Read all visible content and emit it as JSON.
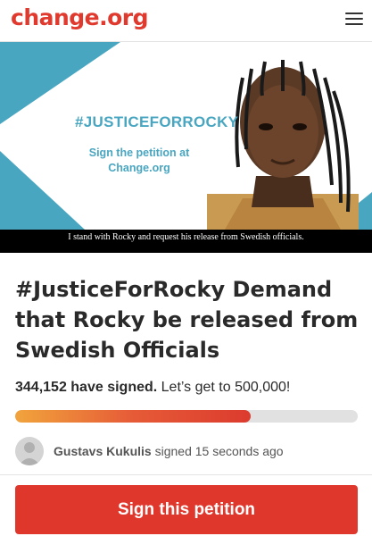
{
  "header": {
    "logo": "change.org",
    "menu_icon": "hamburger-menu-icon"
  },
  "banner": {
    "hashtag": "#JUSTICEFORROCKY",
    "sign_line1": "Sign the petition at",
    "sign_line2": "Change.org",
    "caption": "I stand with Rocky and request his release from Swedish officials.",
    "accent_color": "#49a6c1"
  },
  "petition": {
    "title": "#JusticeForRocky Demand that Rocky be released from Swedish Officials",
    "signed_count": "344,152 have signed.",
    "goal_text": "Let’s get to 500,000!",
    "progress_fraction": 0.688
  },
  "activity": {
    "name": "Gustavs Kukulis",
    "action": "signed 15 seconds ago"
  },
  "cta": {
    "label": "Sign this petition",
    "color": "#e0372c"
  }
}
